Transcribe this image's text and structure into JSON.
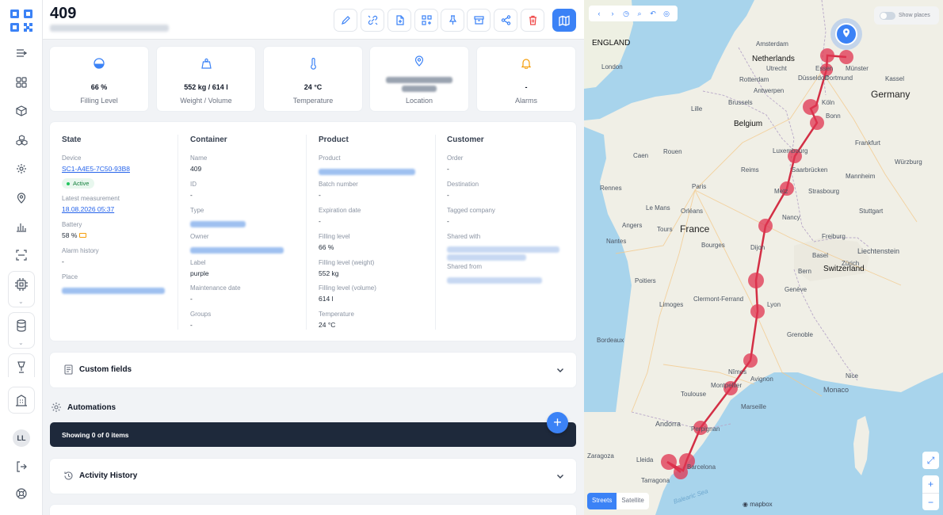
{
  "header": {
    "title": "409",
    "subtitle": "Hidden customer place, blurred"
  },
  "toolbar": {
    "edit": "edit-icon",
    "link": "unlink-icon",
    "export": "file-export-icon",
    "qr": "qr-add-icon",
    "pin": "pin-icon",
    "archive": "archive-icon",
    "share": "share-icon",
    "delete": "trash-icon",
    "map": "map-icon"
  },
  "rail": {
    "avatar": "LL"
  },
  "stats": [
    {
      "icon": "water-drop-icon",
      "value": "66 %",
      "label": "Filling Level"
    },
    {
      "icon": "weight-icon",
      "value": "552 kg / 614 l",
      "label": "Weight / Volume"
    },
    {
      "icon": "thermometer-icon",
      "value": "24 °C",
      "label": "Temperature"
    },
    {
      "icon": "location-pin-icon",
      "value": "",
      "label": "Location"
    },
    {
      "icon": "bell-icon",
      "value": "-",
      "label": "Alarms"
    }
  ],
  "details": {
    "state": {
      "heading": "State",
      "device_label": "Device",
      "device_value": "SC1-A4E5-7C50-93B8",
      "status_badge": "Active",
      "latest_label": "Latest measurement",
      "latest_value": "18.08.2026 05:37",
      "battery_label": "Battery",
      "battery_value": "58 %",
      "alarm_label": "Alarm history",
      "alarm_value": "-",
      "place_label": "Place"
    },
    "container": {
      "heading": "Container",
      "name_label": "Name",
      "name_value": "409",
      "id_label": "ID",
      "id_value": "-",
      "type_label": "Type",
      "owner_label": "Owner",
      "label_label": "Label",
      "label_value": "purple",
      "maint_label": "Maintenance date",
      "maint_value": "-",
      "groups_label": "Groups",
      "groups_value": "-"
    },
    "product": {
      "heading": "Product",
      "product_label": "Product",
      "batch_label": "Batch number",
      "batch_value": "-",
      "exp_label": "Expiration date",
      "exp_value": "-",
      "fill_label": "Filling level",
      "fill_value": "66 %",
      "fillw_label": "Filling level (weight)",
      "fillw_value": "552 kg",
      "fillv_label": "Filling level (volume)",
      "fillv_value": "614 l",
      "temp_label": "Temperature",
      "temp_value": "24 °C"
    },
    "customer": {
      "heading": "Customer",
      "order_label": "Order",
      "order_value": "-",
      "dest_label": "Destination",
      "dest_value": "-",
      "tagged_label": "Tagged company",
      "tagged_value": "-",
      "shared_with_label": "Shared with",
      "shared_from_label": "Shared from"
    }
  },
  "sections": {
    "custom_fields": "Custom fields",
    "automations": "Automations",
    "items_text": "Showing 0 of 0 items",
    "activity": "Activity History"
  },
  "map": {
    "show_places": "Show places",
    "type_streets": "Streets",
    "type_satellite": "Satellite",
    "attribution": "mapbox",
    "sea_label": "Balearic Sea",
    "labels": {
      "england": "ENGLAND",
      "netherlands": "Netherlands",
      "germany": "Germany",
      "belgium": "Belgium",
      "france": "France",
      "switzerland": "Switzerland",
      "liechtenstein": "Liechtenstein",
      "monaco": "Monaco",
      "andorra": "Andorra",
      "london": "London",
      "amsterdam": "Amsterdam",
      "brussels": "Brussels",
      "paris": "Paris",
      "dusseldorf": "Düsseldorf",
      "frankfurt": "Frankfurt",
      "koln": "Köln",
      "strasbourg": "Strasbourg",
      "lyon": "Lyon",
      "geneva": "Genève",
      "marseille": "Marseille",
      "toulouse": "Toulouse",
      "bordeaux": "Bordeaux",
      "nantes": "Nantes",
      "dijon": "Dijon",
      "zaragoza": "Zaragoza",
      "tarragona": "Tarragona",
      "barcelona": "Barcelona",
      "montpellier": "Montpellier",
      "nancy": "Nancy",
      "limoges": "Limoges",
      "tours": "Tours",
      "rennes": "Rennes",
      "caen": "Caen",
      "le_mans": "Le Mans",
      "orleans": "Orléans",
      "reims": "Reims",
      "lille": "Lille",
      "rouen": "Rouen",
      "metz": "Metz",
      "saarbrucken": "Saarbrücken",
      "mannheim": "Mannheim",
      "stuttgart": "Stuttgart",
      "basel": "Basel",
      "bern": "Bern",
      "zurich": "Zürich",
      "clermont": "Clermont-Ferrand",
      "grenoble": "Grenoble",
      "nice": "Nice",
      "nimes": "Nîmes",
      "perpignan": "Perpignan",
      "lleida": "Lleida",
      "dortmund": "Dortmund",
      "essen": "Essen",
      "munster": "Münster",
      "utrecht": "Utrecht",
      "rotterdam": "Rotterdam",
      "antwerpen": "Antwerpen",
      "luxembourg": "Luxembourg",
      "bonn": "Bonn",
      "kassel": "Kassel",
      "wurzburg": "Würzburg",
      "freiburg": "Freiburg",
      "poitiers": "Poitiers",
      "angers": "Angers",
      "bourges": "Bourges",
      "avignon": "Avignon"
    }
  }
}
